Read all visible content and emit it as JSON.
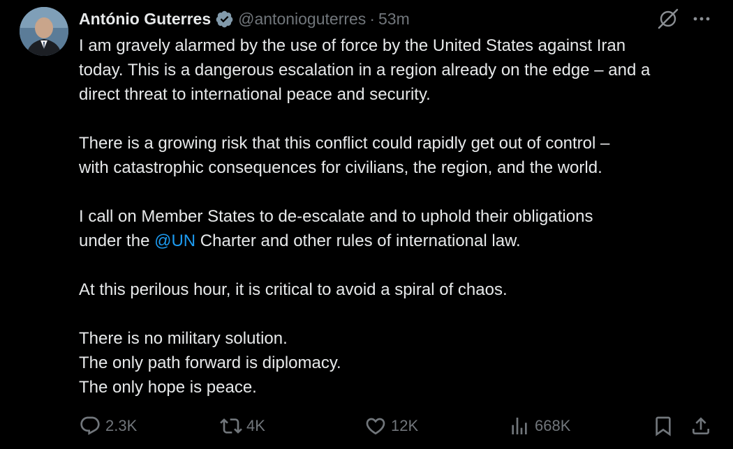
{
  "tweet": {
    "author": {
      "display_name": "António Guterres",
      "handle": "@antonioguterres",
      "verified": true,
      "avatar_icon": "profile-photo"
    },
    "separator": "·",
    "time": "53m",
    "body": {
      "p1": [
        "I am gravely alarmed by the use of force by the United States against Iran",
        "today. This is a dangerous escalation in a region already on the edge – and a",
        "direct threat to international peace and security."
      ],
      "p2": [
        "There is a growing risk that this conflict could rapidly get out of control –",
        "with catastrophic consequences for civilians, the region, and the world."
      ],
      "p3_line1": "I call on Member States to de-escalate and to uphold their obligations",
      "p3_line2_prefix": "under the ",
      "p3_mention": "@UN",
      "p3_line2_suffix": " Charter and other rules of international law.",
      "p4": "At this perilous hour, it is critical to avoid a spiral of chaos.",
      "p5": [
        "There is no military solution.",
        "The only path forward is diplomacy.",
        "The only hope is peace."
      ]
    },
    "metrics": {
      "replies": "2.3K",
      "reposts": "4K",
      "likes": "12K",
      "views": "668K"
    },
    "colors": {
      "background": "#000000",
      "text": "#e7e9ea",
      "muted": "#71767b",
      "link": "#1d9bf0"
    },
    "icons": {
      "verified": "verified-badge-icon",
      "grok": "grok-icon",
      "more": "more-icon",
      "reply": "reply-icon",
      "repost": "repost-icon",
      "like": "like-icon",
      "views": "views-icon",
      "bookmark": "bookmark-icon",
      "share": "share-icon"
    }
  }
}
